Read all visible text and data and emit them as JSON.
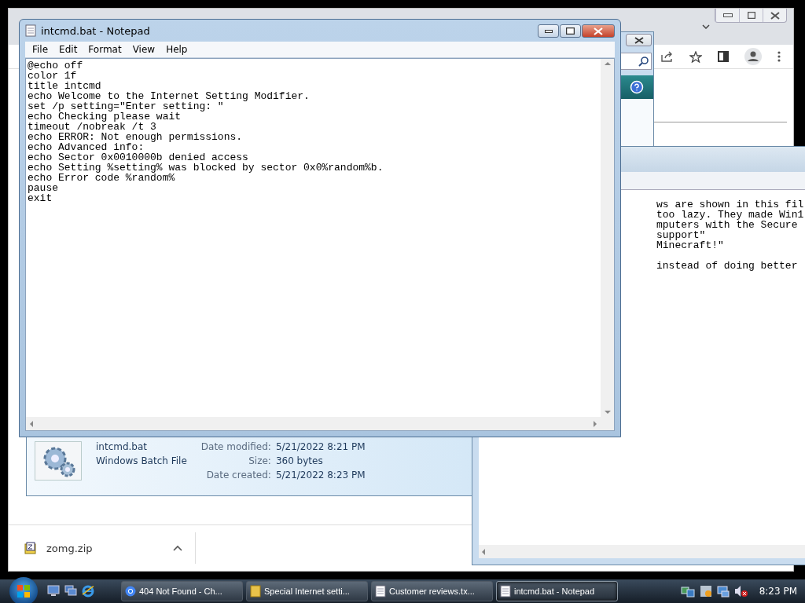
{
  "browser_window": {
    "download": {
      "filename": "zomg.zip"
    }
  },
  "explorer_window": {
    "details": {
      "name": "intcmd.bat",
      "type": "Windows Batch File",
      "fields": [
        {
          "label": "Date modified:",
          "value": "5/21/2022 8:21 PM"
        },
        {
          "label": "Size:",
          "value": "360 bytes"
        },
        {
          "label": "Date created:",
          "value": "5/21/2022 8:23 PM"
        }
      ]
    }
  },
  "reviews_notepad": {
    "paragraphs": [
      [
        "ws are shown in this fil",
        "too lazy. They made Win1",
        "mputers with the Secure",
        "support\"",
        "Minecraft!\""
      ],
      [
        "instead of doing better"
      ]
    ]
  },
  "notepad": {
    "title": "intcmd.bat - Notepad",
    "menu": [
      "File",
      "Edit",
      "Format",
      "View",
      "Help"
    ],
    "lines": [
      "@echo off",
      "color 1f",
      "title intcmd",
      "echo Welcome to the Internet Setting Modifier.",
      "set /p setting=\"Enter setting: \"",
      "echo Checking please wait",
      "timeout /nobreak /t 3",
      "echo ERROR: Not enough permissions.",
      "echo Advanced info:",
      "echo Sector 0x0010000b denied access",
      "echo Setting %setting% was blocked by sector 0x0%random%b.",
      "echo Error code %random%",
      "pause",
      "exit"
    ]
  },
  "taskbar": {
    "items": [
      {
        "kind": "browser",
        "label": "404 Not Found - Ch...",
        "selected": false
      },
      {
        "kind": "folder",
        "label": "Special Internet setti...",
        "selected": false
      },
      {
        "kind": "notepad",
        "label": "Customer reviews.tx...",
        "selected": false
      },
      {
        "kind": "notepad",
        "label": "intcmd.bat - Notepad",
        "selected": true
      }
    ],
    "clock": "8:23 PM"
  }
}
